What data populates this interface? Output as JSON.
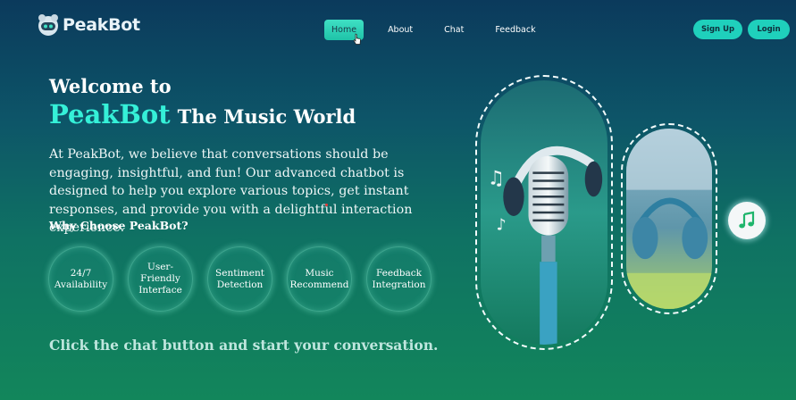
{
  "brand": {
    "name": "PeakBot"
  },
  "nav": {
    "items": [
      "Home",
      "About",
      "Chat",
      "Feedback"
    ],
    "active": "Home"
  },
  "auth": {
    "signup": "Sign Up",
    "login": "Login"
  },
  "hero": {
    "welcome": "Welcome to",
    "brand_highlight": "PeakBot",
    "title_rest": "The Music World",
    "intro": "At PeakBot, we believe that conversations should be engaging, insightful, and fun! Our advanced chatbot is designed to help you explore various topics, get instant responses, and provide you with a delightful interaction experience.",
    "why_heading": "Why Choose PeakBot?",
    "features": [
      {
        "line1": "24/7",
        "line2": "Availability"
      },
      {
        "line1": "User-Friendly",
        "line2": "Interface"
      },
      {
        "line1": "Sentiment",
        "line2": "Detection"
      },
      {
        "line1": "Music",
        "line2": "Recommend"
      },
      {
        "line1": "Feedback",
        "line2": "Integration"
      }
    ],
    "cta": "Click the chat button and start your conversation."
  },
  "images": {
    "large": "microphone-headphones-image",
    "small": "headphones-image"
  },
  "icons": {
    "music_button": "music-note-icon"
  },
  "colors": {
    "accent": "#35f0d8",
    "button": "#1fd0bc",
    "nav_active": "#3fe0c4"
  }
}
